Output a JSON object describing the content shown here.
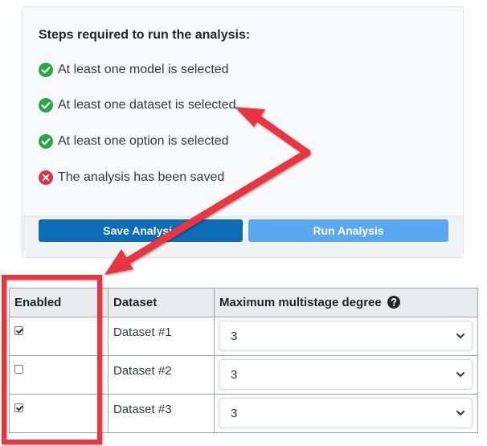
{
  "requirements": {
    "title": "Steps required to run the analysis:",
    "steps": [
      {
        "label": "At least one model is selected",
        "status": "complete",
        "icon": "check-circle-icon"
      },
      {
        "label": "At least one dataset is selected",
        "status": "complete",
        "icon": "check-circle-icon"
      },
      {
        "label": "At least one option is selected",
        "status": "complete",
        "icon": "check-circle-icon"
      },
      {
        "label": "The analysis has been saved",
        "status": "incomplete",
        "icon": "x-circle-icon"
      }
    ],
    "save_label": "Save Analysis",
    "run_label": "Run Analysis"
  },
  "datasets_table": {
    "headers": {
      "enabled": "Enabled",
      "dataset": "Dataset",
      "degree": "Maximum multistage degree"
    },
    "rows": [
      {
        "enabled": true,
        "name": "Dataset #1",
        "degree": "3"
      },
      {
        "enabled": false,
        "name": "Dataset #2",
        "degree": "3"
      },
      {
        "enabled": true,
        "name": "Dataset #3",
        "degree": "3"
      }
    ]
  },
  "colors": {
    "success": "#28a745",
    "danger": "#dc3545",
    "primary": "#0d6cb8",
    "primary_disabled": "#5aa7f2",
    "annotation": "#e8363f"
  }
}
